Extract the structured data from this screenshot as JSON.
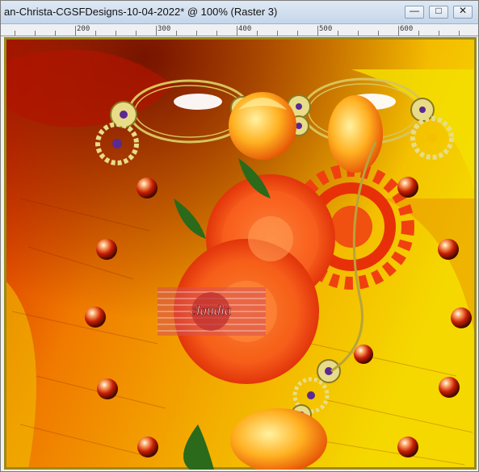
{
  "window": {
    "title": "an-Christa-CGSFDesigns-10-04-2022* @ 100% (Raster 3)",
    "buttons": {
      "minimize": "minimize-icon",
      "maximize": "maximize-icon",
      "close": "close-icon"
    }
  },
  "ruler": {
    "labels": [
      "200",
      "300",
      "400",
      "500",
      "600"
    ]
  },
  "artwork": {
    "watermark": "claudia",
    "colors": {
      "bg_red": "#d21a00",
      "bg_orange": "#f07a00",
      "bg_yellow": "#f5d800",
      "gold": "#d8c45a",
      "frame_gold": "#9a8a1a"
    }
  }
}
